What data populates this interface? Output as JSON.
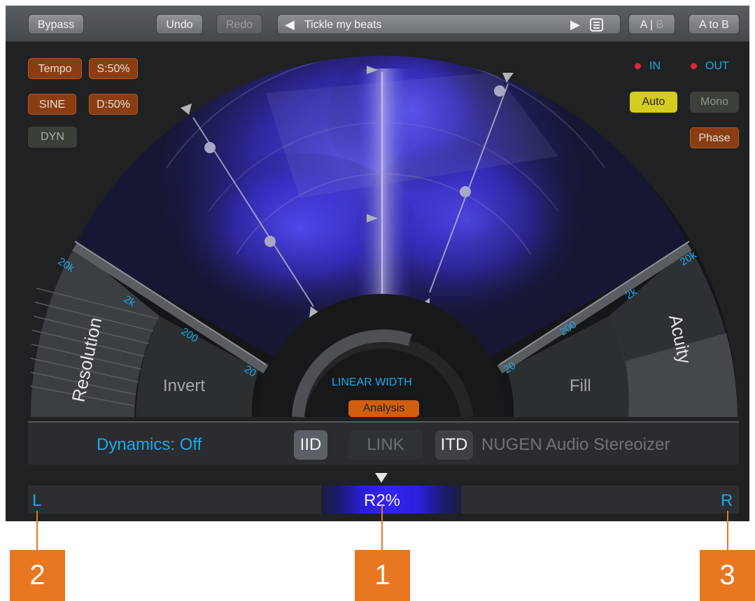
{
  "toolbar": {
    "bypass": "Bypass",
    "undo": "Undo",
    "redo": "Redo",
    "preset_name": "Tickle my beats",
    "ab_left": "A",
    "ab_sep": "|",
    "ab_right": "B",
    "a_to_b": "A to B"
  },
  "left_options": {
    "tempo": "Tempo",
    "speed": "S:50%",
    "sine": "SINE",
    "depth": "D:50%",
    "dyn": "DYN"
  },
  "right_options": {
    "in": "IN",
    "out": "OUT",
    "auto": "Auto",
    "mono": "Mono",
    "phase": "Phase"
  },
  "scale": {
    "left": [
      "20k",
      "2k",
      "200",
      "20"
    ],
    "right": [
      "20",
      "200",
      "2k",
      "20k"
    ]
  },
  "sections": {
    "resolution": "Resolution",
    "invert": "Invert",
    "fill": "Fill",
    "acuity": "Acuity",
    "linear_width": "LINEAR WIDTH",
    "analysis": "Analysis"
  },
  "bottom": {
    "dynamics": "Dynamics: Off",
    "iid": "IID",
    "link": "LINK",
    "itd": "ITD",
    "brand": "NUGEN Audio Stereoizer"
  },
  "width_meter": {
    "value": "R2%",
    "left": "L",
    "right": "R"
  },
  "callouts": [
    "1",
    "2",
    "3"
  ],
  "colors": {
    "accent_blue": "#1ea8e8",
    "orange": "#e87722",
    "auto_yellow": "#d4cc1e"
  }
}
